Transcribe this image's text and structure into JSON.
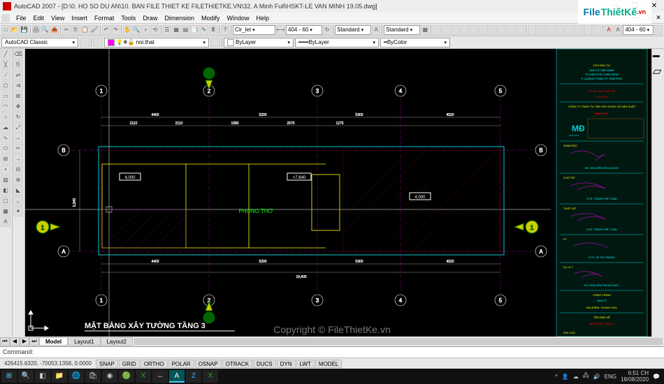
{
  "window": {
    "title": "AutoCAD 2007 - [D:\\0. HO SO DU AN\\10. BAN FILE THIET KE FILETHIETKE.VN\\32. A Minh Full\\HSKT-LE VAN MINH 19.05.dwg]",
    "minimize": "—",
    "maximize": "❐",
    "close": "✕"
  },
  "menu": {
    "items": [
      "File",
      "Edit",
      "View",
      "Insert",
      "Format",
      "Tools",
      "Draw",
      "Dimension",
      "Modify",
      "Window",
      "Help"
    ]
  },
  "toolbar_combos": {
    "dimstyle": "Cir_let",
    "dimscale": "404 - 60",
    "textstyle": "Standard",
    "tablestyle": "Standard"
  },
  "props": {
    "workspace": "AutoCAD Classic",
    "layer": "noi.that",
    "color": "ByLayer",
    "linetype": "ByLayer",
    "lineweight": "ByColor",
    "plotstyle": "404 - 60"
  },
  "tabs": {
    "model": "Model",
    "layout1": "Layout1",
    "layout2": "Layout2"
  },
  "command": {
    "prompt": "Command:"
  },
  "status": {
    "coords": "426415.6320, -70053.1358, 0.0000",
    "toggles": [
      "SNAP",
      "GRID",
      "ORTHO",
      "POLAR",
      "OSNAP",
      "OTRACK",
      "DUCS",
      "DYN",
      "LWT",
      "MODEL"
    ]
  },
  "brand": {
    "prefix": "File",
    "mid": "ThiếtKế",
    "suffix": ".vn"
  },
  "watermark": "Copyright © FileThietKe.vn",
  "drawing": {
    "title": "MẶT BẰNG XÂY TƯỜNG TẦNG 3",
    "grids_h": [
      "1",
      "2",
      "3",
      "4",
      "5"
    ],
    "grids_v_top": "B",
    "grids_v_bot": "A",
    "section_mark": "1",
    "room": "PHÒNG THỜ",
    "elev1": "4,000",
    "elev2": "+7.640",
    "elev3": "4,000",
    "dims_main": "19,400",
    "dims_sec": [
      "4400",
      "5200",
      "5300",
      "4520"
    ],
    "dims_small": [
      "2110",
      "2110",
      "1580",
      "2575",
      "1275"
    ],
    "dim_v": "5,945"
  },
  "titleblock": {
    "owner_lbl": "CHỦ ĐẦU TƯ",
    "owner": "ANH LÊ VĂN MINH",
    "addr1": "TỔ DÂN PHỐ CHÂU BÌNH",
    "addr2": "P. QUẢNG CHÂU-TP. SẦM SƠN",
    "proj_lbl": "HỒ SƠ XIN THIẾT KẾ",
    "proj_lbl2": "THI CÔNG",
    "company_pre": "CÔNG TY TNHH TƯ VẤN XÂY DỰNG VÀ SẢN XUẤT",
    "company": "MINH ĐẠT",
    "logo": "MĐ",
    "logo_sub": "MINH ĐẠT",
    "director_lbl": "GIÁM ĐỐC",
    "director": "KS. NGUYỄN HỮU DƯỢC",
    "chair_lbl": "CHỦ TRÌ",
    "chair": "KTS. TRỊNH THẾ TUẤN",
    "design_lbl": "THIẾT KẾ",
    "design": "KTS. TRỊNH THẾ TUẤN",
    "check_lbl": "KT",
    "check": "KTS. LÊ THỊ TRANG",
    "qlkt_lbl": "Q.L.K.T",
    "qlkt": "KS. NGUYỄN TRUNG ĐỨC",
    "works_lbl": "CÔNG TRÌNH",
    "works": "NHÀ Ở",
    "loc_lbl": "ĐỊA ĐIỂM: THANH HÓA",
    "sheet_lbl": "TÊN BẢN VẼ",
    "sheet": "MẶT BẰNG TẦNG 3",
    "note": "GHI CHÚ"
  },
  "taskbar": {
    "lang": "ENG",
    "time": "6:51 CH",
    "date": "18/08/2020"
  }
}
